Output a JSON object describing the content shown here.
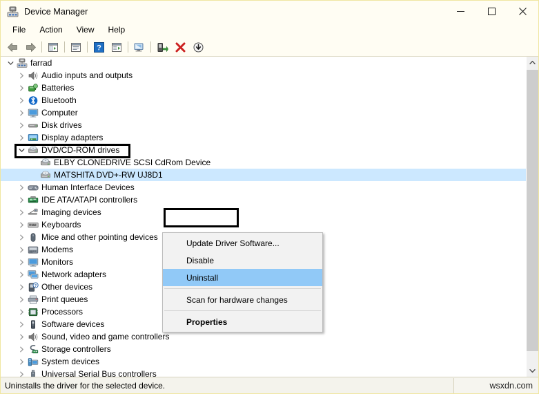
{
  "window": {
    "title": "Device Manager",
    "icon": "device-manager-icon",
    "minimize_label": "—",
    "maximize_label": "□",
    "close_label": "✕"
  },
  "menubar": {
    "items": [
      {
        "label": "File",
        "name": "menu-file"
      },
      {
        "label": "Action",
        "name": "menu-action"
      },
      {
        "label": "View",
        "name": "menu-view"
      },
      {
        "label": "Help",
        "name": "menu-help"
      }
    ]
  },
  "toolbar": {
    "buttons": [
      {
        "name": "back-icon",
        "title": "Back"
      },
      {
        "name": "forward-icon",
        "title": "Forward"
      },
      {
        "name": "show-hide-console-tree-icon",
        "title": "Show/Hide Console Tree"
      },
      {
        "name": "properties-icon",
        "title": "Properties"
      },
      {
        "name": "help-icon",
        "title": "Help"
      },
      {
        "name": "scan-for-hardware-changes-icon",
        "title": "Scan for hardware changes"
      },
      {
        "name": "update-driver-icon",
        "title": "Update Driver Software"
      },
      {
        "name": "disable-device-icon",
        "title": "Disable device"
      },
      {
        "name": "uninstall-device-icon",
        "title": "Uninstall device"
      },
      {
        "name": "install-legacy-hardware-icon",
        "title": "Add legacy hardware"
      }
    ]
  },
  "tree": {
    "root": {
      "label": "farrad",
      "icon": "computer-node-icon",
      "expanded": true
    },
    "items": [
      {
        "label": "Audio inputs and outputs",
        "icon": "speaker-icon",
        "level": 1,
        "expandable": true,
        "expanded": false
      },
      {
        "label": "Batteries",
        "icon": "battery-icon",
        "level": 1,
        "expandable": true,
        "expanded": false
      },
      {
        "label": "Bluetooth",
        "icon": "bluetooth-icon",
        "level": 1,
        "expandable": true,
        "expanded": false
      },
      {
        "label": "Computer",
        "icon": "monitor-icon",
        "level": 1,
        "expandable": true,
        "expanded": false
      },
      {
        "label": "Disk drives",
        "icon": "disk-drive-icon",
        "level": 1,
        "expandable": true,
        "expanded": false
      },
      {
        "label": "Display adapters",
        "icon": "display-adapter-icon",
        "level": 1,
        "expandable": true,
        "expanded": false
      },
      {
        "label": "DVD/CD-ROM drives",
        "icon": "dvd-drive-icon",
        "level": 1,
        "expandable": true,
        "expanded": true,
        "highlighted_box": true
      },
      {
        "label": "ELBY CLONEDRIVE SCSI CdRom Device",
        "icon": "dvd-drive-icon",
        "level": 2,
        "expandable": false,
        "expanded": false
      },
      {
        "label": "MATSHITA DVD+-RW UJ8D1",
        "icon": "dvd-drive-icon",
        "level": 2,
        "expandable": false,
        "expanded": false,
        "selected": true
      },
      {
        "label": "Human Interface Devices",
        "icon": "hid-icon",
        "level": 1,
        "expandable": true,
        "expanded": false
      },
      {
        "label": "IDE ATA/ATAPI controllers",
        "icon": "ide-controller-icon",
        "level": 1,
        "expandable": true,
        "expanded": false
      },
      {
        "label": "Imaging devices",
        "icon": "imaging-device-icon",
        "level": 1,
        "expandable": true,
        "expanded": false
      },
      {
        "label": "Keyboards",
        "icon": "keyboard-icon",
        "level": 1,
        "expandable": true,
        "expanded": false
      },
      {
        "label": "Mice and other pointing devices",
        "icon": "mouse-icon",
        "level": 1,
        "expandable": true,
        "expanded": false
      },
      {
        "label": "Modems",
        "icon": "modem-icon",
        "level": 1,
        "expandable": true,
        "expanded": false
      },
      {
        "label": "Monitors",
        "icon": "monitor-icon",
        "level": 1,
        "expandable": true,
        "expanded": false
      },
      {
        "label": "Network adapters",
        "icon": "network-adapter-icon",
        "level": 1,
        "expandable": true,
        "expanded": false
      },
      {
        "label": "Other devices",
        "icon": "other-device-icon",
        "level": 1,
        "expandable": true,
        "expanded": false
      },
      {
        "label": "Print queues",
        "icon": "printer-icon",
        "level": 1,
        "expandable": true,
        "expanded": false
      },
      {
        "label": "Processors",
        "icon": "processor-icon",
        "level": 1,
        "expandable": true,
        "expanded": false
      },
      {
        "label": "Software devices",
        "icon": "software-device-icon",
        "level": 1,
        "expandable": true,
        "expanded": false
      },
      {
        "label": "Sound, video and game controllers",
        "icon": "speaker-icon",
        "level": 1,
        "expandable": true,
        "expanded": false
      },
      {
        "label": "Storage controllers",
        "icon": "storage-controller-icon",
        "level": 1,
        "expandable": true,
        "expanded": false
      },
      {
        "label": "System devices",
        "icon": "system-device-icon",
        "level": 1,
        "expandable": true,
        "expanded": false
      },
      {
        "label": "Universal Serial Bus controllers",
        "icon": "usb-icon",
        "level": 1,
        "expandable": true,
        "expanded": false
      }
    ]
  },
  "context_menu": {
    "items": [
      {
        "label": "Update Driver Software...",
        "name": "ctx-update-driver-software",
        "selected": false,
        "bold": false
      },
      {
        "label": "Disable",
        "name": "ctx-disable",
        "selected": false,
        "bold": false
      },
      {
        "label": "Uninstall",
        "name": "ctx-uninstall",
        "selected": true,
        "bold": false
      },
      {
        "separator": true
      },
      {
        "label": "Scan for hardware changes",
        "name": "ctx-scan-for-hardware-changes",
        "selected": false,
        "bold": false
      },
      {
        "separator": true
      },
      {
        "label": "Properties",
        "name": "ctx-properties",
        "selected": false,
        "bold": true
      }
    ]
  },
  "statusbar": {
    "text": "Uninstalls the driver for the selected device.",
    "watermark": "wsxdn.com"
  },
  "scrollbar": {
    "up_glyph": "∧",
    "down_glyph": "∨"
  },
  "colors": {
    "selection_tree": "#cce8ff",
    "selection_menu": "#91c9f7",
    "annotation": "#000000",
    "window_border": "#f0e6a0"
  }
}
